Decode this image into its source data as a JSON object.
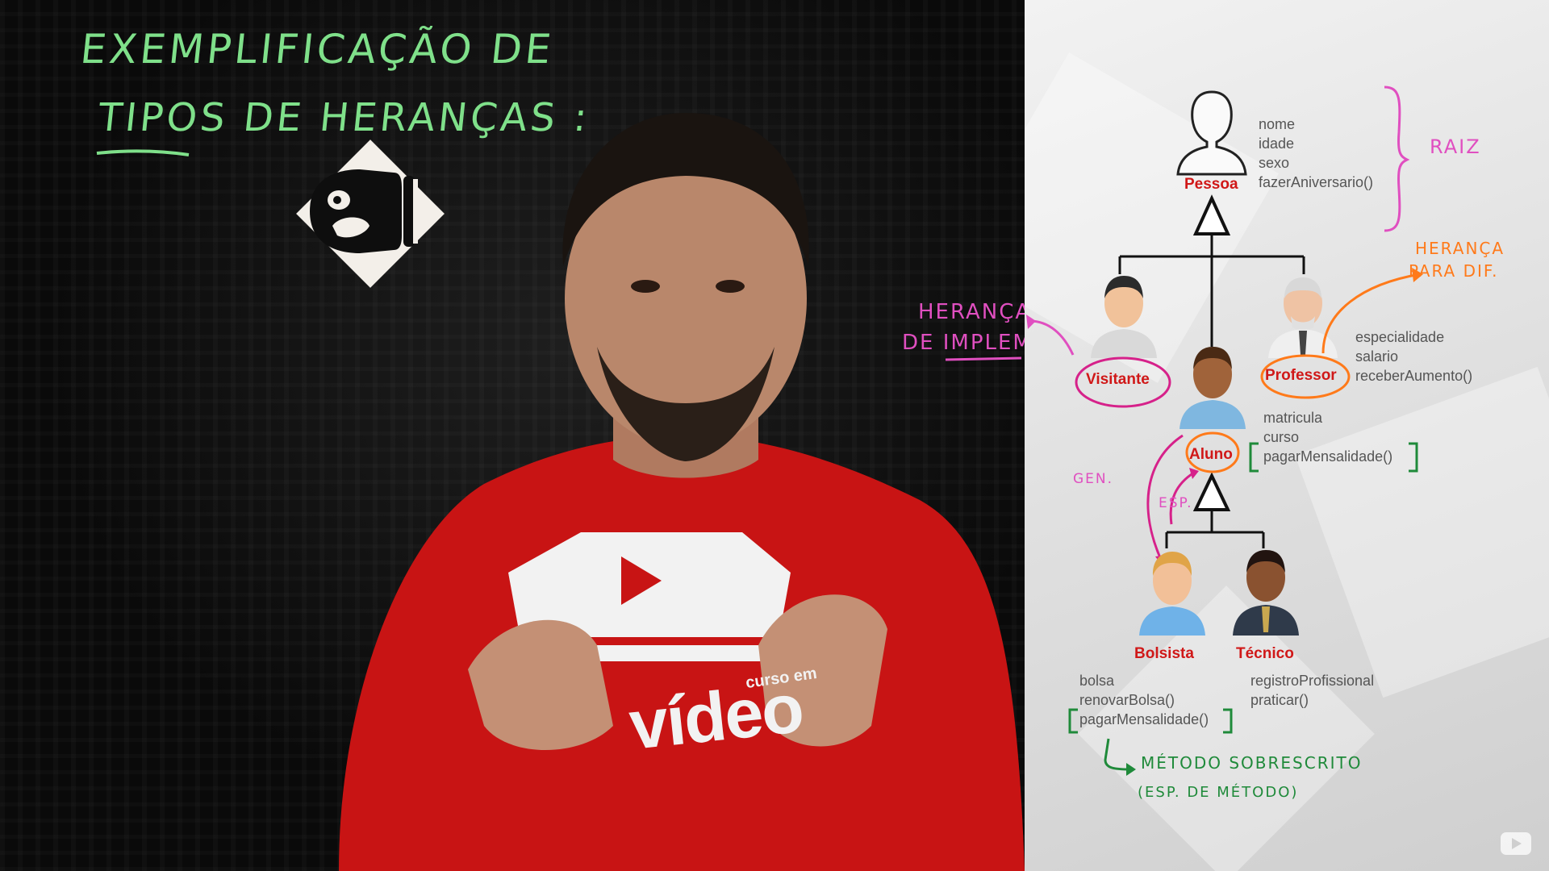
{
  "title": {
    "line1": "EXEMPLIFICAÇÃO   DE",
    "line2": "TIPOS  DE  HERANÇAS :"
  },
  "shirt": {
    "brand_small": "curso em",
    "brand_big": "vídeo"
  },
  "classes": {
    "pessoa": {
      "name": "Pessoa",
      "attrs": [
        "nome",
        "idade",
        "sexo",
        "fazerAniversario()"
      ]
    },
    "visitante": {
      "name": "Visitante"
    },
    "professor": {
      "name": "Professor",
      "attrs": [
        "especialidade",
        "salario",
        "receberAumento()"
      ]
    },
    "aluno": {
      "name": "Aluno",
      "attrs": [
        "matricula",
        "curso",
        "pagarMensalidade()"
      ]
    },
    "bolsista": {
      "name": "Bolsista",
      "attrs": [
        "bolsa",
        "renovarBolsa()",
        "pagarMensalidade()"
      ]
    },
    "tecnico": {
      "name": "Técnico",
      "attrs": [
        "registroProfissional",
        "praticar()"
      ]
    }
  },
  "annotations": {
    "raiz": "RAIZ",
    "heranca_dif_1": "HERANÇA",
    "heranca_dif_2": "PARA DIF.",
    "heranca_impl_1": "HERANÇA",
    "heranca_impl_2": "DE IMPLEM.",
    "gen": "GEN.",
    "esp": "ESP.",
    "metodo_1": "MÉTODO  SOBRESCRITO",
    "metodo_2": "(ESP. DE MÉTODO)"
  },
  "colors": {
    "green_marker": "#7fe08a",
    "magenta_marker": "#e04fc0",
    "orange_marker": "#ff7a1a",
    "dark_green_marker": "#1f8a3a",
    "class_name_red": "#d01818",
    "shirt_red": "#c81414"
  },
  "icons": [
    "bullet-bill-icon",
    "youtube-logo-icon",
    "person-outline-icon"
  ]
}
